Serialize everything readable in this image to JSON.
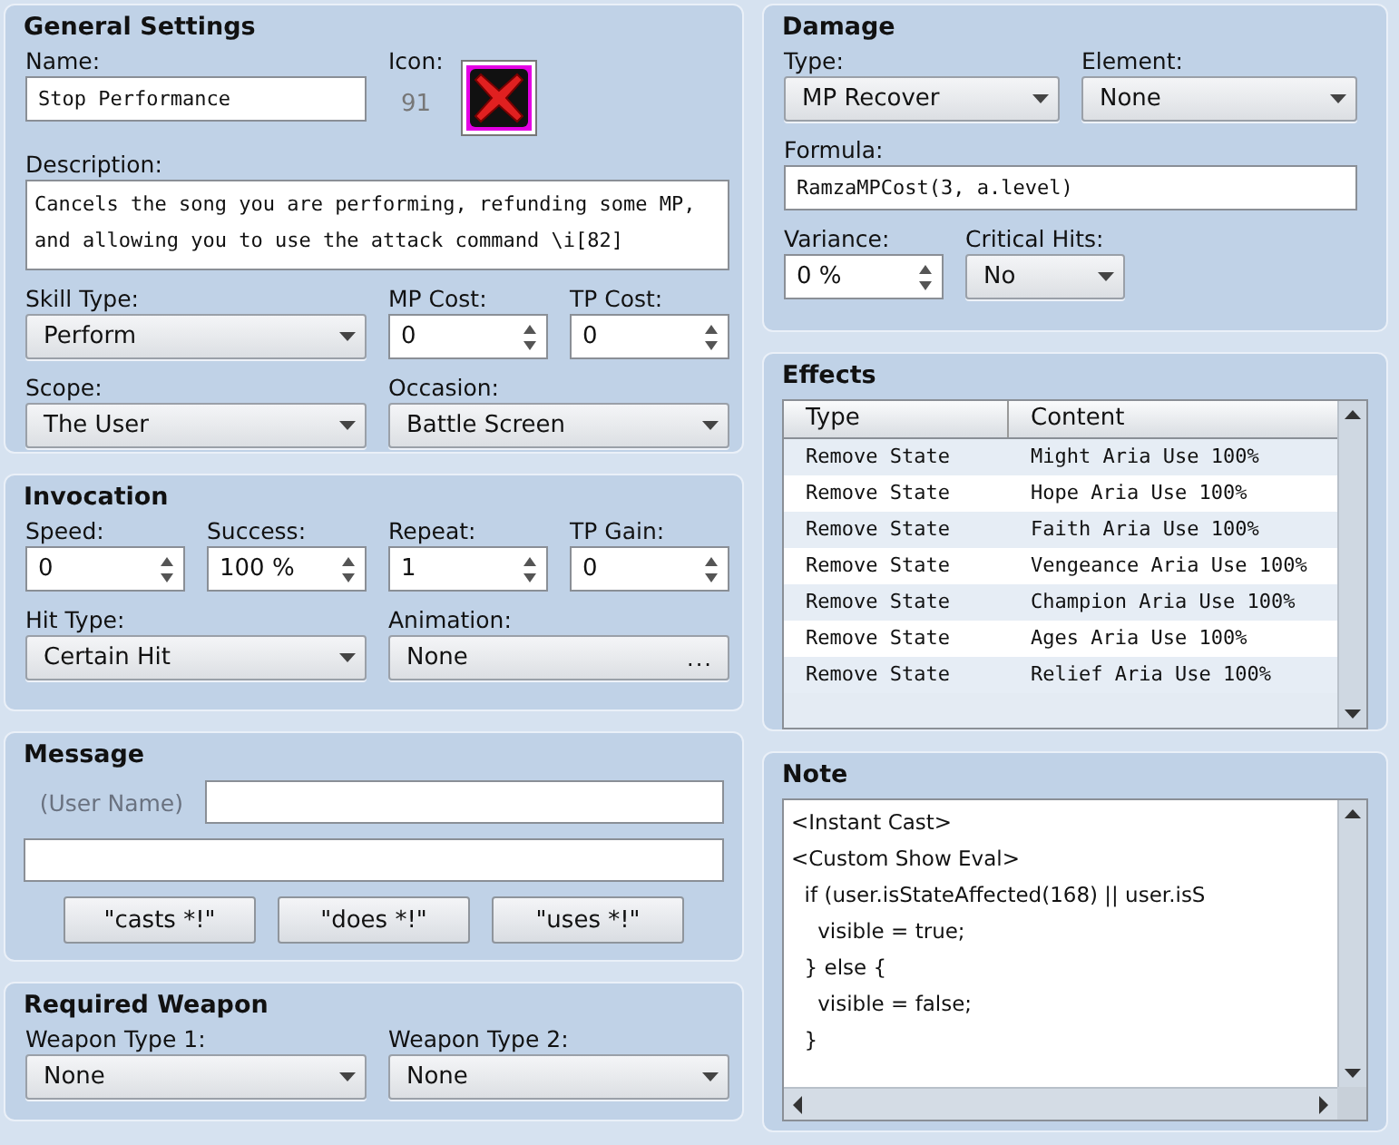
{
  "general_settings": {
    "title": "General Settings",
    "name": {
      "kind": "text",
      "label": "Name:",
      "value": "Stop Performance"
    },
    "icon": {
      "label": "Icon:",
      "index": "91"
    },
    "description": {
      "kind": "textarea",
      "label": "Description:",
      "value": "Cancels the song you are performing, refunding some MP, and allowing you to use the attack command \\i[82]"
    },
    "skill_type": {
      "kind": "combo",
      "label": "Skill Type:",
      "value": "Perform"
    },
    "mp_cost": {
      "kind": "spin",
      "label": "MP Cost:",
      "value": "0"
    },
    "tp_cost": {
      "kind": "spin",
      "label": "TP Cost:",
      "value": "0"
    },
    "scope": {
      "kind": "combo",
      "label": "Scope:",
      "value": "The User"
    },
    "occasion": {
      "kind": "combo",
      "label": "Occasion:",
      "value": "Battle Screen"
    }
  },
  "invocation": {
    "title": "Invocation",
    "speed": {
      "kind": "spin",
      "label": "Speed:",
      "value": "0"
    },
    "success": {
      "kind": "spin",
      "label": "Success:",
      "value": "100 %"
    },
    "repeat": {
      "kind": "spin",
      "label": "Repeat:",
      "value": "1"
    },
    "tp_gain": {
      "kind": "spin",
      "label": "TP Gain:",
      "value": "0"
    },
    "hit_type": {
      "kind": "combo",
      "label": "Hit Type:",
      "value": "Certain Hit"
    },
    "animation": {
      "kind": "picker",
      "label": "Animation:",
      "value": "None",
      "button": "..."
    }
  },
  "message": {
    "title": "Message",
    "user_name_label": "(User Name)",
    "buttons": [
      "\"casts *!\"",
      "\"does *!\"",
      "\"uses *!\""
    ]
  },
  "required_weapon": {
    "title": "Required Weapon",
    "weapon_type_1": {
      "kind": "combo",
      "label": "Weapon Type 1:",
      "value": "None"
    },
    "weapon_type_2": {
      "kind": "combo",
      "label": "Weapon Type 2:",
      "value": "None"
    }
  },
  "damage": {
    "title": "Damage",
    "type": {
      "kind": "combo",
      "label": "Type:",
      "value": "MP Recover"
    },
    "element": {
      "kind": "combo",
      "label": "Element:",
      "value": "None"
    },
    "formula": {
      "kind": "text",
      "label": "Formula:",
      "value": "RamzaMPCost(3, a.level)"
    },
    "variance": {
      "kind": "spin",
      "label": "Variance:",
      "value": "0 %"
    },
    "critical_hits": {
      "kind": "combo",
      "label": "Critical Hits:",
      "value": "No"
    }
  },
  "effects": {
    "title": "Effects",
    "columns": [
      "Type",
      "Content"
    ],
    "rows": [
      [
        "Remove State",
        "Might Aria Use 100%"
      ],
      [
        "Remove State",
        "Hope Aria Use 100%"
      ],
      [
        "Remove State",
        "Faith Aria Use 100%"
      ],
      [
        "Remove State",
        "Vengeance Aria Use 100%"
      ],
      [
        "Remove State",
        "Champion Aria Use 100%"
      ],
      [
        "Remove State",
        "Ages Aria Use 100%"
      ],
      [
        "Remove State",
        "Relief Aria Use 100%"
      ]
    ]
  },
  "note": {
    "title": "Note",
    "lines": [
      "<Instant Cast>",
      "<Custom Show Eval>",
      "  if (user.isStateAffected(168) || user.isS",
      "    visible = true;",
      "  } else {",
      "    visible = false;",
      "  }"
    ]
  }
}
